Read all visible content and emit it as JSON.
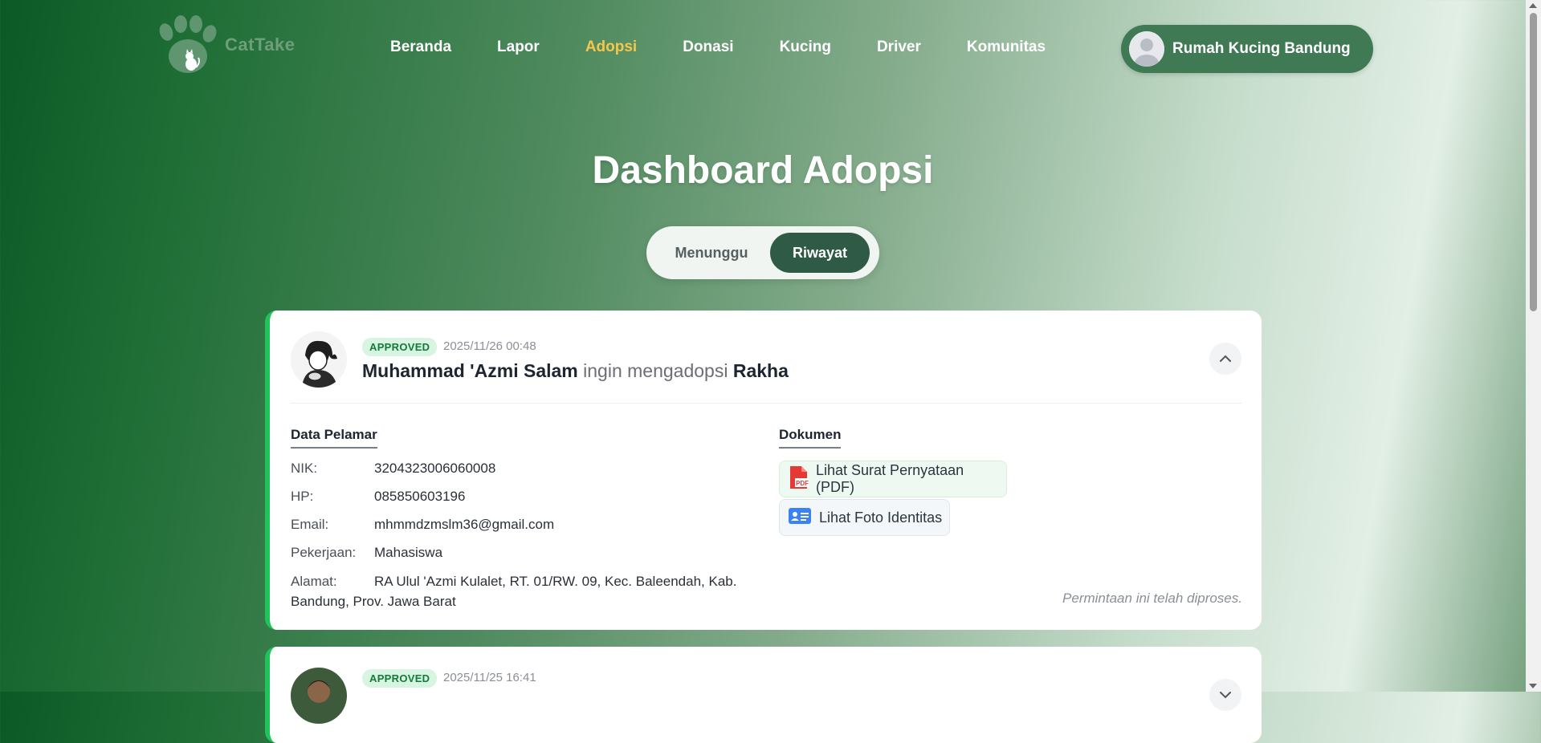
{
  "brand": {
    "name": "CatTake"
  },
  "nav": {
    "items": [
      {
        "label": "Beranda"
      },
      {
        "label": "Lapor"
      },
      {
        "label": "Adopsi"
      },
      {
        "label": "Donasi"
      },
      {
        "label": "Kucing"
      },
      {
        "label": "Driver"
      },
      {
        "label": "Komunitas"
      }
    ],
    "active": "Adopsi"
  },
  "profile": {
    "name": "Rumah Kucing Bandung"
  },
  "page": {
    "title": "Dashboard Adopsi"
  },
  "tabs": {
    "pending": "Menunggu",
    "history": "Riwayat",
    "selected": "Riwayat"
  },
  "requests": [
    {
      "status": "APPROVED",
      "date": "2025/11/26 00:48",
      "applicant": "Muhammad 'Azmi Salam",
      "connector": "ingin mengadopsi",
      "cat": "Rakha",
      "applicant_section": "Data Pelamar",
      "fields": {
        "nik_label": "NIK:",
        "nik": "3204323006060008",
        "hp_label": "HP:",
        "hp": "085850603196",
        "email_label": "Email:",
        "email": "mhmmdzmslm36@gmail.com",
        "job_label": "Pekerjaan:",
        "job": "Mahasiswa",
        "address_label": "Alamat:",
        "address": "RA Ulul 'Azmi Kulalet, RT. 01/RW. 09, Kec. Baleendah, Kab. Bandung, Prov. Jawa Barat"
      },
      "documents_section": "Dokumen",
      "documents": {
        "statement": "Lihat Surat Pernyataan (PDF)",
        "identity": "Lihat Foto Identitas"
      },
      "processed_note": "Permintaan ini telah diproses."
    },
    {
      "status": "APPROVED",
      "date": "2025/11/25 16:41"
    }
  ],
  "colors": {
    "accent": "#20c25a",
    "nav_active": "#f5c74a",
    "tab_active": "#2f5a45",
    "profile_bg": "#3f7a55"
  }
}
